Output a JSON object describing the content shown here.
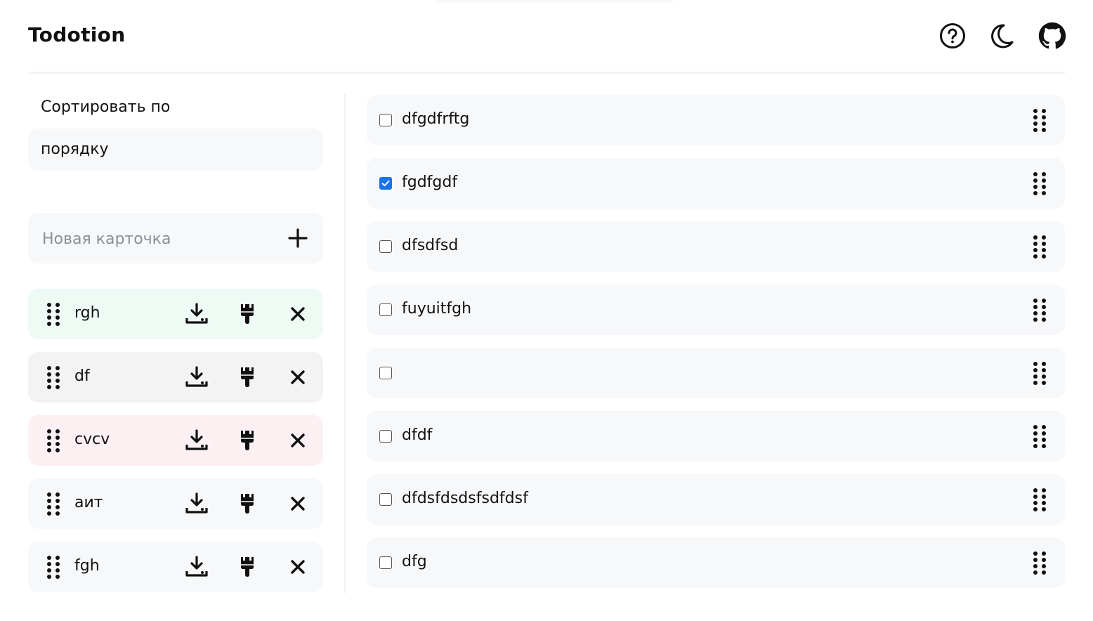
{
  "app": {
    "title": "Todotion"
  },
  "header_icons": [
    "help-circle-icon",
    "moon-icon",
    "github-icon"
  ],
  "sidebar": {
    "sort_label": "Сортировать по",
    "sort_value": "порядку",
    "new_card_placeholder": "Новая карточка",
    "cards": [
      {
        "name": "rgh",
        "color": "#eefaf4"
      },
      {
        "name": "df",
        "color": "#f3f3f4"
      },
      {
        "name": "cvcv",
        "color": "#fcf0f3"
      },
      {
        "name": "аит",
        "color": "#f7f8fa"
      },
      {
        "name": "fgh",
        "color": "#f7f8fa"
      }
    ]
  },
  "todos": [
    {
      "text": "dfgdfrftg",
      "done": false
    },
    {
      "text": "fgdfgdf",
      "done": true
    },
    {
      "text": "dfsdfsd",
      "done": false
    },
    {
      "text": "fuyuitfgh",
      "done": false
    },
    {
      "text": "",
      "done": false
    },
    {
      "text": "dfdf",
      "done": false
    },
    {
      "text": "dfdsfdsdsfsdfdsf",
      "done": false
    },
    {
      "text": "dfg",
      "done": false
    }
  ],
  "colors": {
    "accent": "#1a73e8",
    "panel": "#f7f8fa"
  }
}
